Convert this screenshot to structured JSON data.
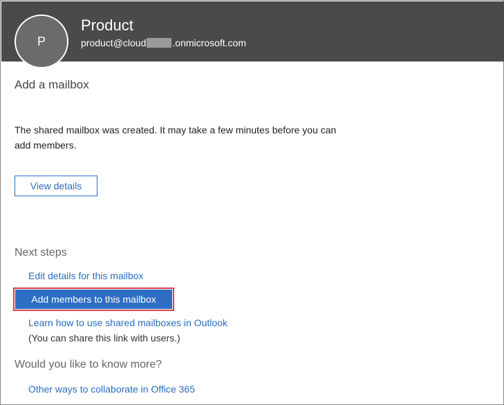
{
  "header": {
    "avatar_initial": "P",
    "name": "Product",
    "email_prefix": "product@cloud",
    "email_suffix": ".onmicrosoft.com"
  },
  "main": {
    "section_title": "Add a mailbox",
    "message": "The shared mailbox was created. It may take a few minutes before you can add members.",
    "view_details_label": "View details"
  },
  "next_steps": {
    "title": "Next steps",
    "edit_details_link": "Edit details for this mailbox",
    "add_members_button": "Add members to this mailbox",
    "learn_link": "Learn how to use shared mailboxes in Outlook",
    "share_note": "(You can share this link with users.)"
  },
  "more": {
    "title": "Would you like to know more?",
    "other_ways_link": "Other ways to collaborate in Office 365"
  },
  "colors": {
    "header_bg": "#4a4a4a",
    "accent": "#2d6ec4",
    "link": "#2b6cbf",
    "highlight": "#d9404a"
  }
}
